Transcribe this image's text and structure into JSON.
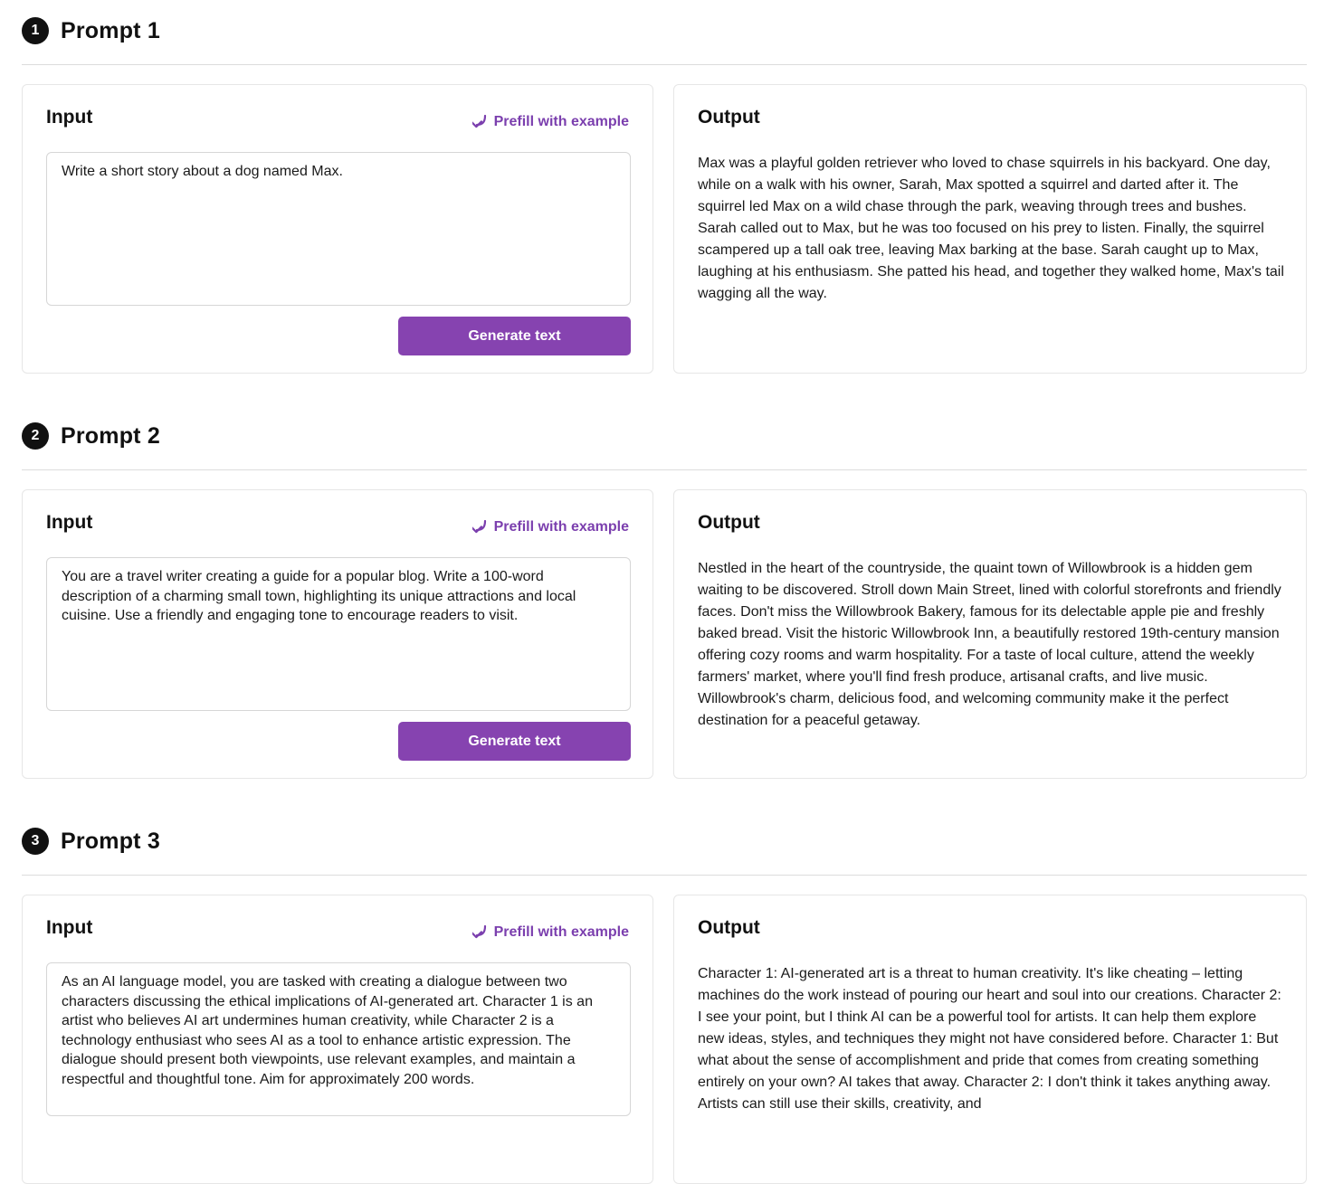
{
  "accent_color": "#8643b0",
  "labels": {
    "input_title": "Input",
    "output_title": "Output",
    "prefill": "Prefill with example",
    "generate": "Generate text"
  },
  "icons": {
    "prefill": "arrow-down-left-curve-icon"
  },
  "sections": [
    {
      "number": "1",
      "title": "Prompt 1",
      "input": "Write a short story about a dog named Max.",
      "output": "Max was a playful golden retriever who loved to chase squirrels in his backyard. One day, while on a walk with his owner, Sarah, Max spotted a squirrel and darted after it. The squirrel led Max on a wild chase through the park, weaving through trees and bushes. Sarah called out to Max, but he was too focused on his prey to listen. Finally, the squirrel scampered up a tall oak tree, leaving Max barking at the base. Sarah caught up to Max, laughing at his enthusiasm. She patted his head, and together they walked home, Max's tail wagging all the way."
    },
    {
      "number": "2",
      "title": "Prompt 2",
      "input": "You are a travel writer creating a guide for a popular blog. Write a 100-word description of a charming small town, highlighting its unique attractions and local cuisine. Use a friendly and engaging tone to encourage readers to visit.",
      "output": "Nestled in the heart of the countryside, the quaint town of Willowbrook is a hidden gem waiting to be discovered. Stroll down Main Street, lined with colorful storefronts and friendly faces. Don't miss the Willowbrook Bakery, famous for its delectable apple pie and freshly baked bread. Visit the historic Willowbrook Inn, a beautifully restored 19th-century mansion offering cozy rooms and warm hospitality. For a taste of local culture, attend the weekly farmers' market, where you'll find fresh produce, artisanal crafts, and live music. Willowbrook's charm, delicious food, and welcoming community make it the perfect destination for a peaceful getaway."
    },
    {
      "number": "3",
      "title": "Prompt 3",
      "input": "As an AI language model, you are tasked with creating a dialogue between two characters discussing the ethical implications of AI-generated art. Character 1 is an artist who believes AI art undermines human creativity, while Character 2 is a technology enthusiast who sees AI as a tool to enhance artistic expression. The dialogue should present both viewpoints, use relevant examples, and maintain a respectful and thoughtful tone. Aim for approximately 200 words.",
      "output": "Character 1: AI-generated art is a threat to human creativity. It's like cheating – letting machines do the work instead of pouring our heart and soul into our creations. Character 2: I see your point, but I think AI can be a powerful tool for artists. It can help them explore new ideas, styles, and techniques they might not have considered before. Character 1: But what about the sense of accomplishment and pride that comes from creating something entirely on your own? AI takes that away. Character 2: I don't think it takes anything away. Artists can still use their skills, creativity, and"
    }
  ]
}
